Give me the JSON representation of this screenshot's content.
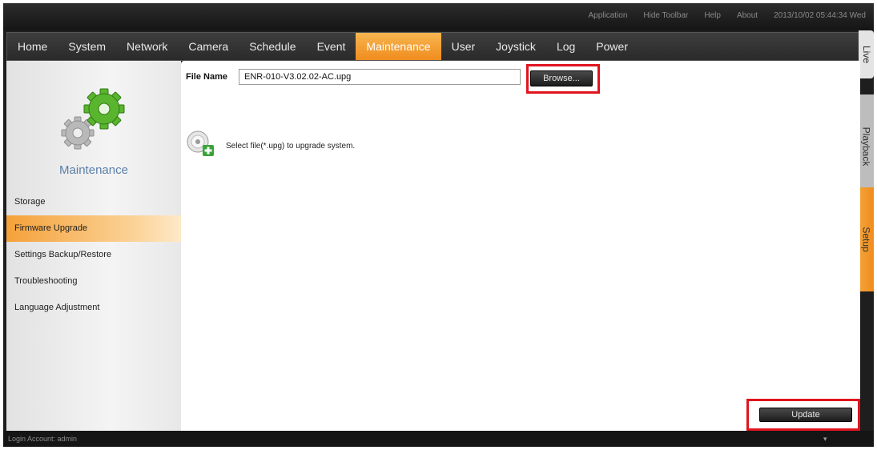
{
  "toolbar": {
    "links": [
      "Application",
      "Hide Toolbar",
      "Help",
      "About"
    ],
    "datetime": "2013/10/02 05:44:34 Wed"
  },
  "nav": {
    "items": [
      "Home",
      "System",
      "Network",
      "Camera",
      "Schedule",
      "Event",
      "Maintenance",
      "User",
      "Joystick",
      "Log",
      "Power"
    ],
    "active": "Maintenance",
    "active_color": "#f08c1e"
  },
  "vtabs": {
    "live": "Live",
    "playback": "Playback",
    "setup": "Setup"
  },
  "sidebar": {
    "icon": "gears-icon",
    "title": "Maintenance",
    "items": [
      "Storage",
      "Firmware Upgrade",
      "Settings Backup/Restore",
      "Troubleshooting",
      "Language Adjustment"
    ],
    "active": "Firmware Upgrade"
  },
  "content": {
    "file_label": "File Name",
    "file_value": "ENR-010-V3.02.02-AC.upg",
    "browse_label": "Browse...",
    "info_icon": "cd-install-icon",
    "info_text": "Select file(*.upg) to upgrade system.",
    "update_label": "Update",
    "highlight_color": "#e0141e"
  },
  "status": {
    "login": "Login Account: admin",
    "icon": "speaker-icon"
  }
}
